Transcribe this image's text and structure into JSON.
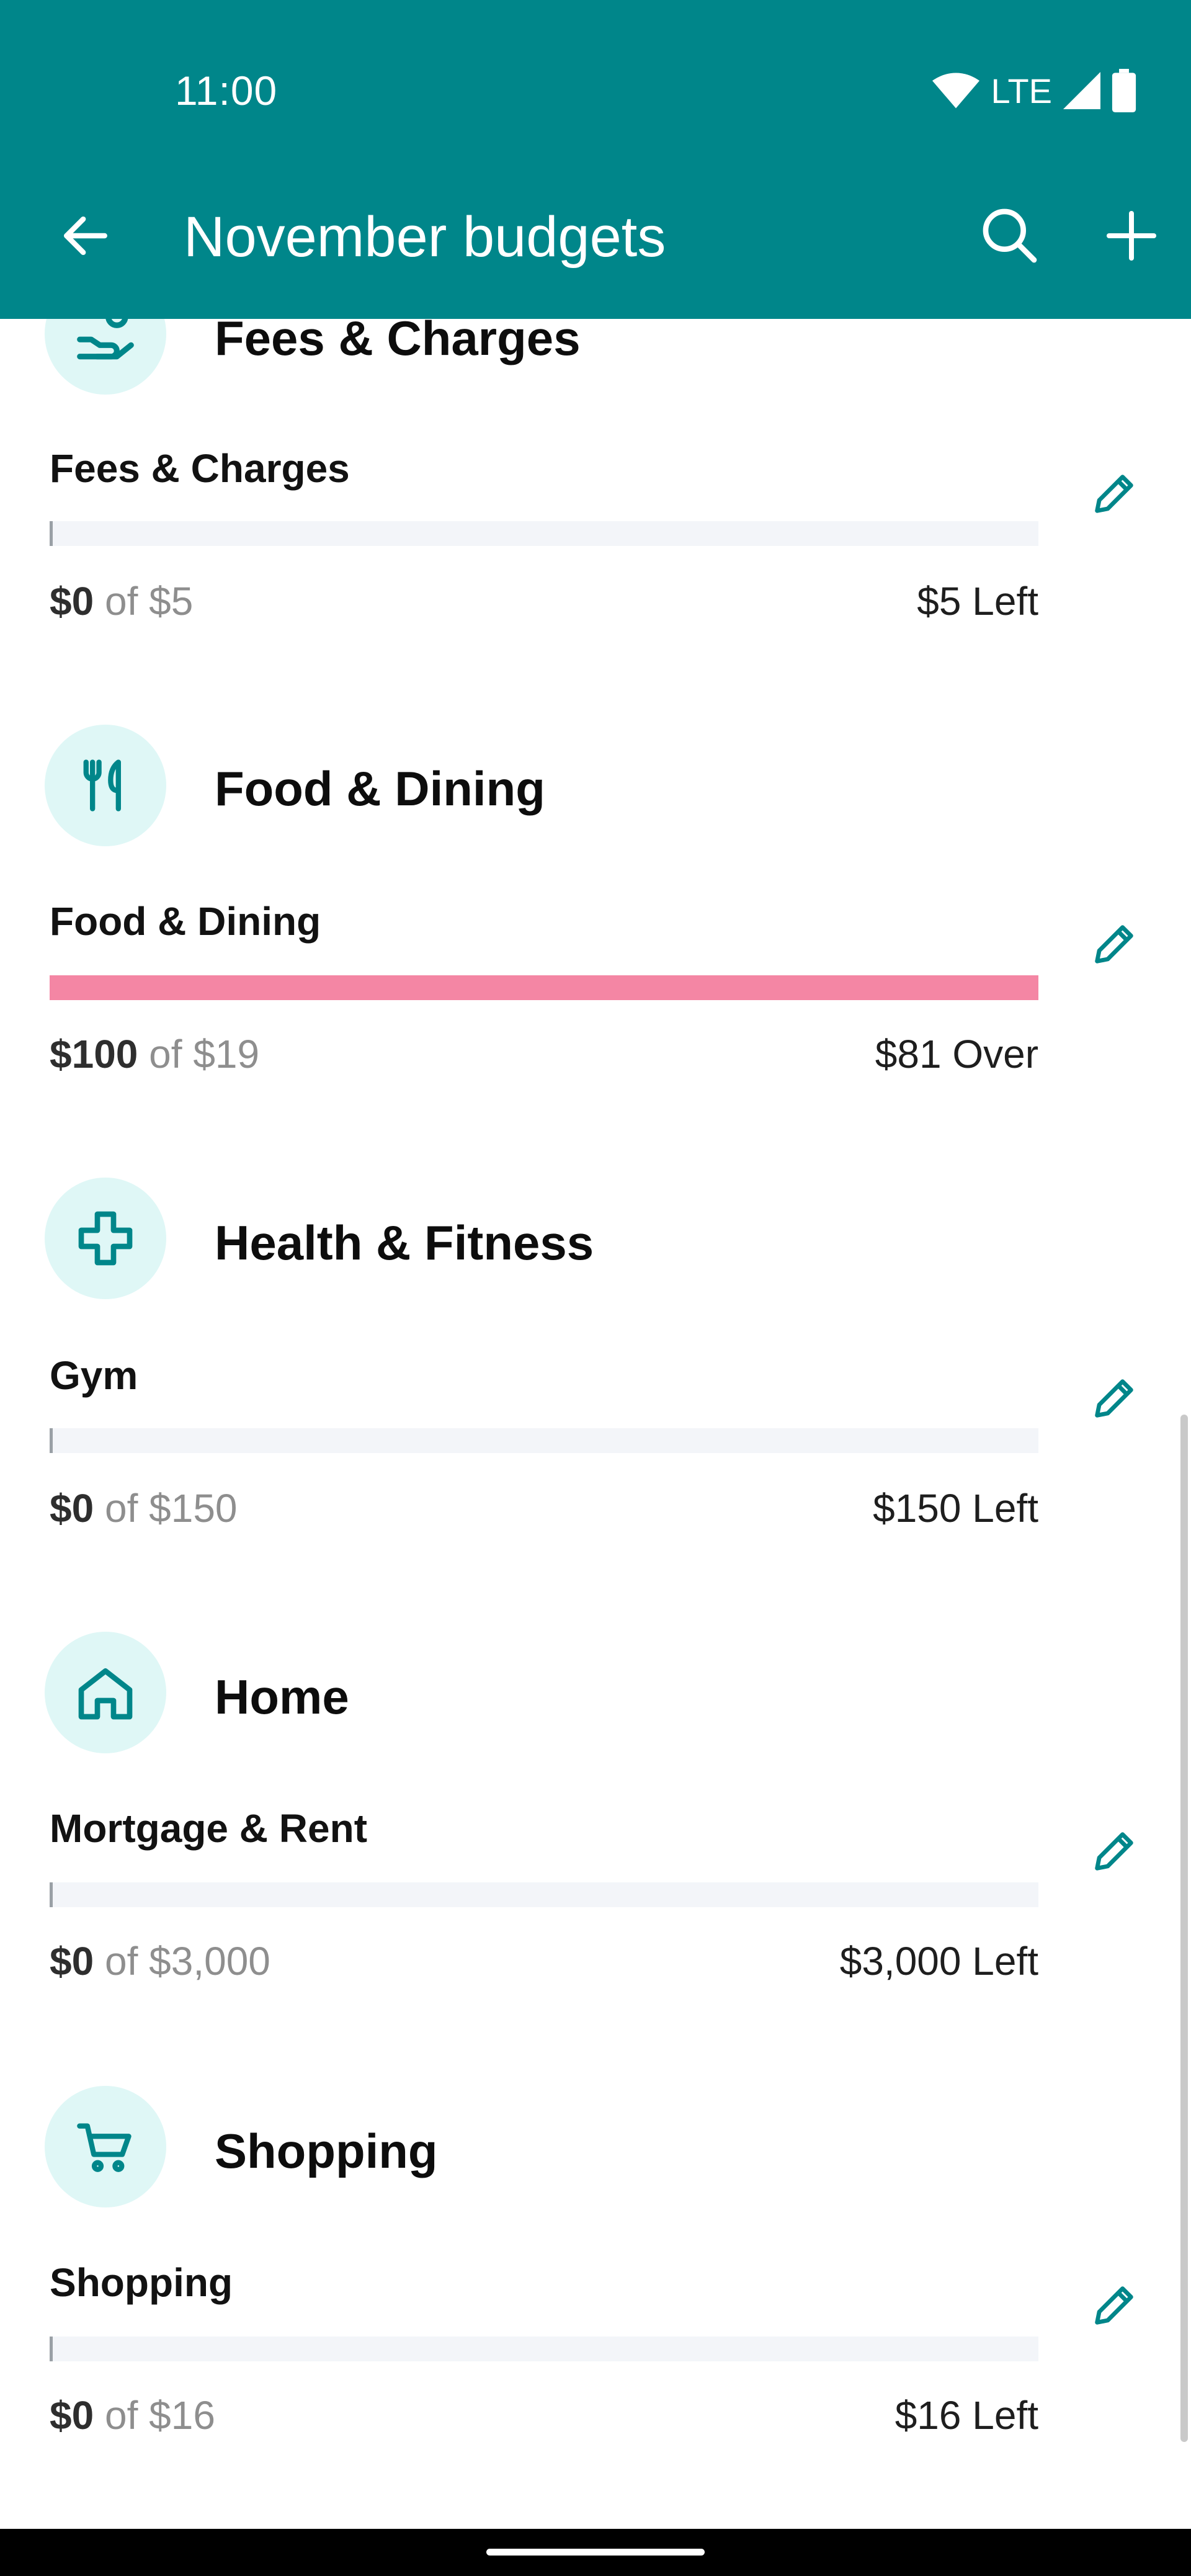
{
  "status_bar": {
    "time": "11:00",
    "network": "LTE"
  },
  "app_bar": {
    "title": "November budgets"
  },
  "groups": [
    {
      "title": "Fees & Charges",
      "icon": "hand-coin-icon",
      "budget": {
        "name": "Fees & Charges",
        "spent": "$0",
        "of_text": " of $5",
        "remaining": "$5 Left",
        "progress": 0
      }
    },
    {
      "title": "Food & Dining",
      "icon": "fork-knife-icon",
      "budget": {
        "name": "Food & Dining",
        "spent": "$100",
        "of_text": " of $19",
        "remaining": "$81 Over",
        "progress": 1.0
      }
    },
    {
      "title": "Health & Fitness",
      "icon": "health-cross-icon",
      "budget": {
        "name": "Gym",
        "spent": "$0",
        "of_text": " of $150",
        "remaining": "$150 Left",
        "progress": 0
      }
    },
    {
      "title": "Home",
      "icon": "house-icon",
      "budget": {
        "name": "Mortgage & Rent",
        "spent": "$0",
        "of_text": " of $3,000",
        "remaining": "$3,000 Left",
        "progress": 0
      }
    },
    {
      "title": "Shopping",
      "icon": "shopping-cart-icon",
      "budget": {
        "name": "Shopping",
        "spent": "$0",
        "of_text": " of $16",
        "remaining": "$16 Left",
        "progress": 0
      }
    }
  ],
  "colors": {
    "app_bar": "#00868a",
    "accent": "#00868a",
    "icon_bg": "#dff7f6",
    "over_budget": "#f486a4",
    "track": "#f3f5f9"
  }
}
